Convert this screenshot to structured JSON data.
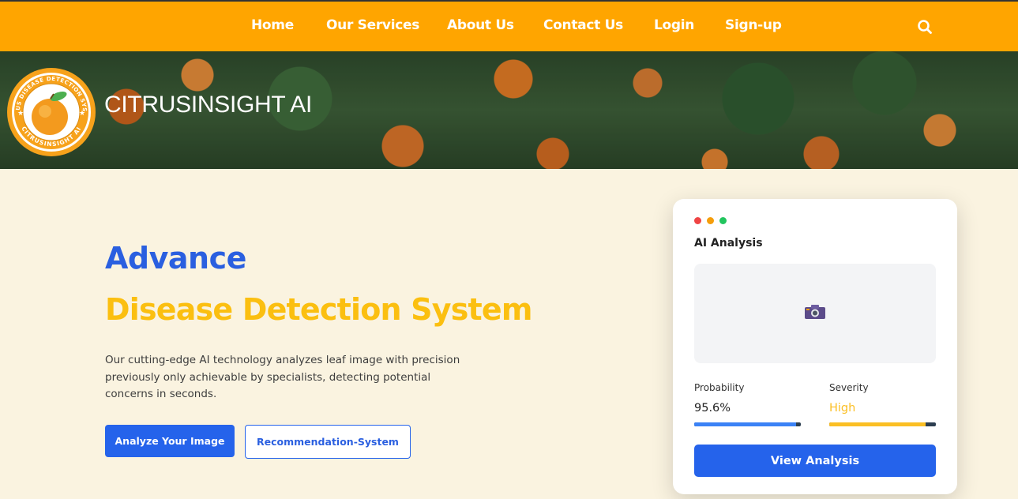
{
  "nav": {
    "items": [
      {
        "label": "Home"
      },
      {
        "label": "Our Services"
      },
      {
        "label": "About Us"
      },
      {
        "label": "Contact Us"
      },
      {
        "label": "Login"
      },
      {
        "label": "Sign-up"
      }
    ],
    "search_icon": "search-icon",
    "background": "#ffa500"
  },
  "banner": {
    "brand": "CITRUSINSIGHT AI",
    "logo_ring_text": "CITRUS DISEASE DETECTION SYSTEM",
    "logo_bottom_text": "CITRUSINSIGHT AI"
  },
  "hero": {
    "title_line1": "Advance",
    "title_line2": "Disease Detection System",
    "description": "Our cutting-edge AI technology analyzes leaf image with precision previously only achievable by specialists, detecting potential concerns in seconds.",
    "primary_button": "Analyze Your Image",
    "secondary_button": "Recommendation-System",
    "colors": {
      "blue": "#2563eb",
      "yellow": "#fbbf10"
    }
  },
  "card": {
    "window_dots": [
      "#ef4444",
      "#f59e0b",
      "#22c55e"
    ],
    "title": "AI Analysis",
    "image_icon": "camera-icon",
    "probability": {
      "label": "Probability",
      "value": "95.6%",
      "fill": 0.956,
      "color": "#3b82f6"
    },
    "severity": {
      "label": "Severity",
      "value": "High",
      "fill": 0.9,
      "color": "#fbbf24"
    },
    "button": "View Analysis"
  }
}
